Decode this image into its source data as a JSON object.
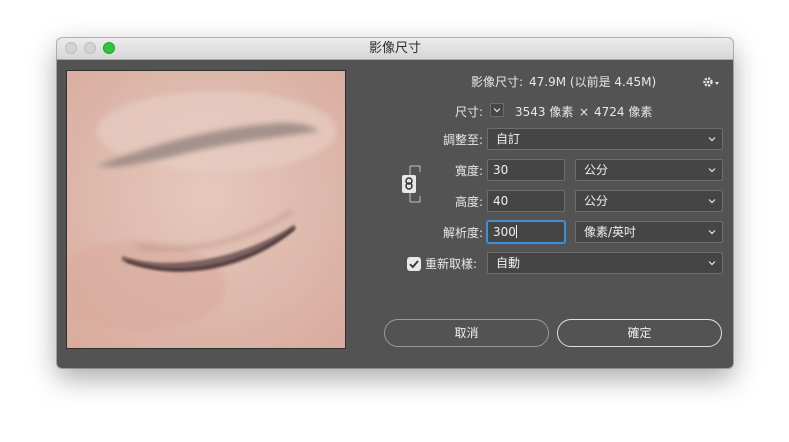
{
  "window": {
    "title": "影像尺寸"
  },
  "info": {
    "image_size_label": "影像尺寸:",
    "image_size_value": "47.9M (以前是 4.45M)",
    "dimensions_label": "尺寸:",
    "dimensions_width": "3543 像素",
    "dimensions_x": "×",
    "dimensions_height": "4724 像素"
  },
  "fit_to": {
    "label": "調整至:",
    "value": "自訂"
  },
  "width": {
    "label": "寬度:",
    "value": "30",
    "unit": "公分"
  },
  "height": {
    "label": "高度:",
    "value": "40",
    "unit": "公分"
  },
  "resolution": {
    "label": "解析度:",
    "value": "300",
    "unit": "像素/英吋"
  },
  "resample": {
    "label": "重新取樣:",
    "checked": true,
    "value": "自動"
  },
  "buttons": {
    "cancel": "取消",
    "ok": "確定"
  },
  "icons": {
    "settings": "gear-icon",
    "link": "chain-link-icon"
  }
}
